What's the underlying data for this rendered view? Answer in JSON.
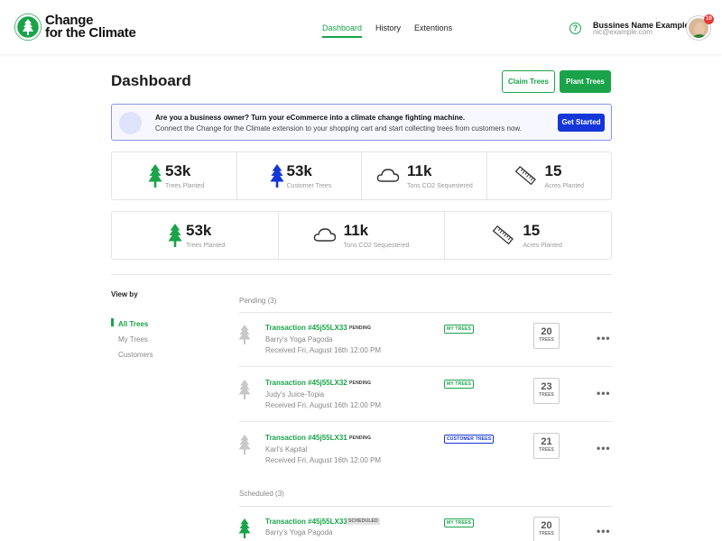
{
  "header": {
    "logo_line1": "Change",
    "logo_line2": "for the Climate",
    "nav": [
      "Dashboard",
      "History",
      "Extentions"
    ],
    "business_name": "Bussines Name Example...",
    "email": "nic@example.com",
    "notification_count": "10",
    "help_glyph": "?"
  },
  "page": {
    "title": "Dashboard",
    "claim_button": "Claim Trees",
    "plant_button": "Plant Trees"
  },
  "banner": {
    "title": "Are you a business owner? Turn your eCommerce into a climate change fighting machine.",
    "subtitle": "Connect the Change for the Climate extension to your shopping cart and start collecting trees from customers now.",
    "cta": "Get Started"
  },
  "stats_row1": [
    {
      "icon": "tree-icon",
      "color": "#1aa34a",
      "value": "53k",
      "label": "Trees Planted"
    },
    {
      "icon": "tree-icon",
      "color": "#1436d9",
      "value": "53k",
      "label": "Customer Trees"
    },
    {
      "icon": "cloud-icon",
      "color": "#333333",
      "value": "11k",
      "label": "Tons CO2 Sequestered"
    },
    {
      "icon": "ruler-icon",
      "color": "#333333",
      "value": "15",
      "label": "Acres Planted"
    }
  ],
  "stats_row2": [
    {
      "icon": "tree-icon",
      "color": "#1aa34a",
      "value": "53k",
      "label": "Trees Planted"
    },
    {
      "icon": "cloud-icon",
      "color": "#333333",
      "value": "11k",
      "label": "Tons CO2 Sequestered"
    },
    {
      "icon": "ruler-icon",
      "color": "#333333",
      "value": "15",
      "label": "Acres Planted"
    }
  ],
  "view_by": {
    "title": "View by",
    "items": [
      "All Trees",
      "My Trees",
      "Customers"
    ]
  },
  "pending": {
    "label": "Pending (3)",
    "items": [
      {
        "title": "Transaction #45j55LX33",
        "status": "PENDING",
        "name": "Barry's Yoga Pagoda",
        "received": "Received Fri, August 16th 12:00 PM",
        "tag": "MY TREES",
        "count": "20",
        "unit": "TREES"
      },
      {
        "title": "Transaction #45j55LX32",
        "status": "PENDING",
        "name": "Judy's Juice-Topia",
        "received": "Received Fri, August 16th 12:00 PM",
        "tag": "MY TREES",
        "count": "23",
        "unit": "TREES"
      },
      {
        "title": "Transaction #45j55LX31",
        "status": "PENDING",
        "name": "Karl's Kapital",
        "received": "Received Fri, August 16th 12:00 PM",
        "tag": "CUSTOMER TREES",
        "count": "21",
        "unit": "TREES"
      }
    ]
  },
  "scheduled": {
    "label": "Scheduled (3)",
    "items": [
      {
        "title": "Transaction #45j55LX33",
        "status": "SCHEDULED",
        "name": "Barry's Yoga Pagoda",
        "tag": "MY TREES",
        "count": "20",
        "unit": "TREES"
      }
    ]
  },
  "menu_glyph": "•••",
  "colors": {
    "brand_green": "#1aa34a",
    "brand_blue": "#1436d9",
    "muted_tree": "#c8c8c8"
  }
}
